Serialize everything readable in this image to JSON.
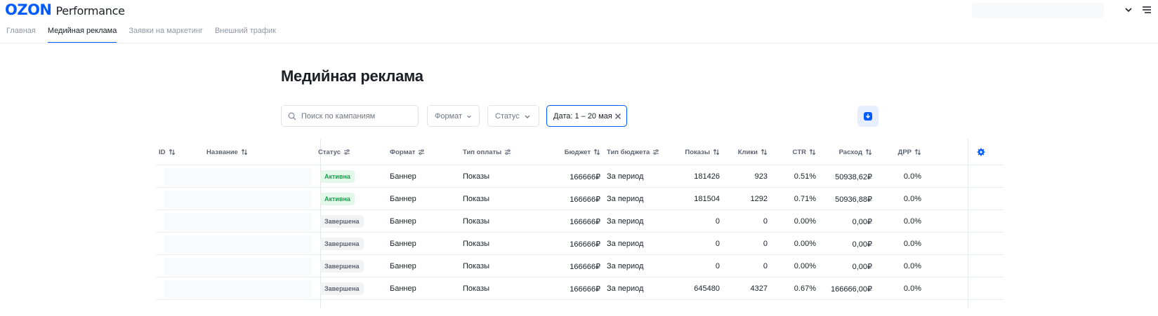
{
  "header": {
    "logo_main": "OZON",
    "logo_sub": "Performance"
  },
  "nav": {
    "tabs": [
      {
        "label": "Главная",
        "active": false
      },
      {
        "label": "Медийная реклама",
        "active": true
      },
      {
        "label": "Заявки на маркетинг",
        "active": false
      },
      {
        "label": "Внешний трафик",
        "active": false
      }
    ]
  },
  "page": {
    "title": "Медийная реклама"
  },
  "filters": {
    "search_placeholder": "Поиск по кампаниям",
    "format_label": "Формат",
    "status_label": "Статус",
    "date_label": "Дата: 1 – 20 мая"
  },
  "table": {
    "columns": {
      "id": "ID",
      "name": "Название",
      "status": "Статус",
      "format": "Формат",
      "payment": "Тип оплаты",
      "budget": "Бюджет",
      "budget_type": "Тип бюджета",
      "impressions": "Показы",
      "clicks": "Клики",
      "ctr": "CTR",
      "spend": "Расход",
      "drr": "ДРР"
    },
    "rows": [
      {
        "status": "Активна",
        "status_kind": "active",
        "format": "Баннер",
        "payment": "Показы",
        "budget": "166666₽",
        "budget_type": "За период",
        "impressions": "181426",
        "clicks": "923",
        "ctr": "0.51%",
        "spend": "50938,62₽",
        "drr": "0.0%"
      },
      {
        "status": "Активна",
        "status_kind": "active",
        "format": "Баннер",
        "payment": "Показы",
        "budget": "166666₽",
        "budget_type": "За период",
        "impressions": "181504",
        "clicks": "1292",
        "ctr": "0.71%",
        "spend": "50936,88₽",
        "drr": "0.0%"
      },
      {
        "status": "Завершена",
        "status_kind": "done",
        "format": "Баннер",
        "payment": "Показы",
        "budget": "166666₽",
        "budget_type": "За период",
        "impressions": "0",
        "clicks": "0",
        "ctr": "0.00%",
        "spend": "0,00₽",
        "drr": "0.0%"
      },
      {
        "status": "Завершена",
        "status_kind": "done",
        "format": "Баннер",
        "payment": "Показы",
        "budget": "166666₽",
        "budget_type": "За период",
        "impressions": "0",
        "clicks": "0",
        "ctr": "0.00%",
        "spend": "0,00₽",
        "drr": "0.0%"
      },
      {
        "status": "Завершена",
        "status_kind": "done",
        "format": "Баннер",
        "payment": "Показы",
        "budget": "166666₽",
        "budget_type": "За период",
        "impressions": "0",
        "clicks": "0",
        "ctr": "0.00%",
        "spend": "0,00₽",
        "drr": "0.0%"
      },
      {
        "status": "Завершена",
        "status_kind": "done",
        "format": "Баннер",
        "payment": "Показы",
        "budget": "166666₽",
        "budget_type": "За период",
        "impressions": "645480",
        "clicks": "4327",
        "ctr": "0.67%",
        "spend": "166666,00₽",
        "drr": "0.0%"
      }
    ]
  },
  "colors": {
    "brand": "#005bff",
    "active_badge_bg": "#e4f8ea",
    "active_badge_text": "#19a04a",
    "done_badge_bg": "#f1f3f5"
  },
  "icons": [
    "chevron-down-icon",
    "menu-icon",
    "search-icon",
    "close-icon",
    "download-icon",
    "sort-icon",
    "filter-icon",
    "gear-icon"
  ]
}
